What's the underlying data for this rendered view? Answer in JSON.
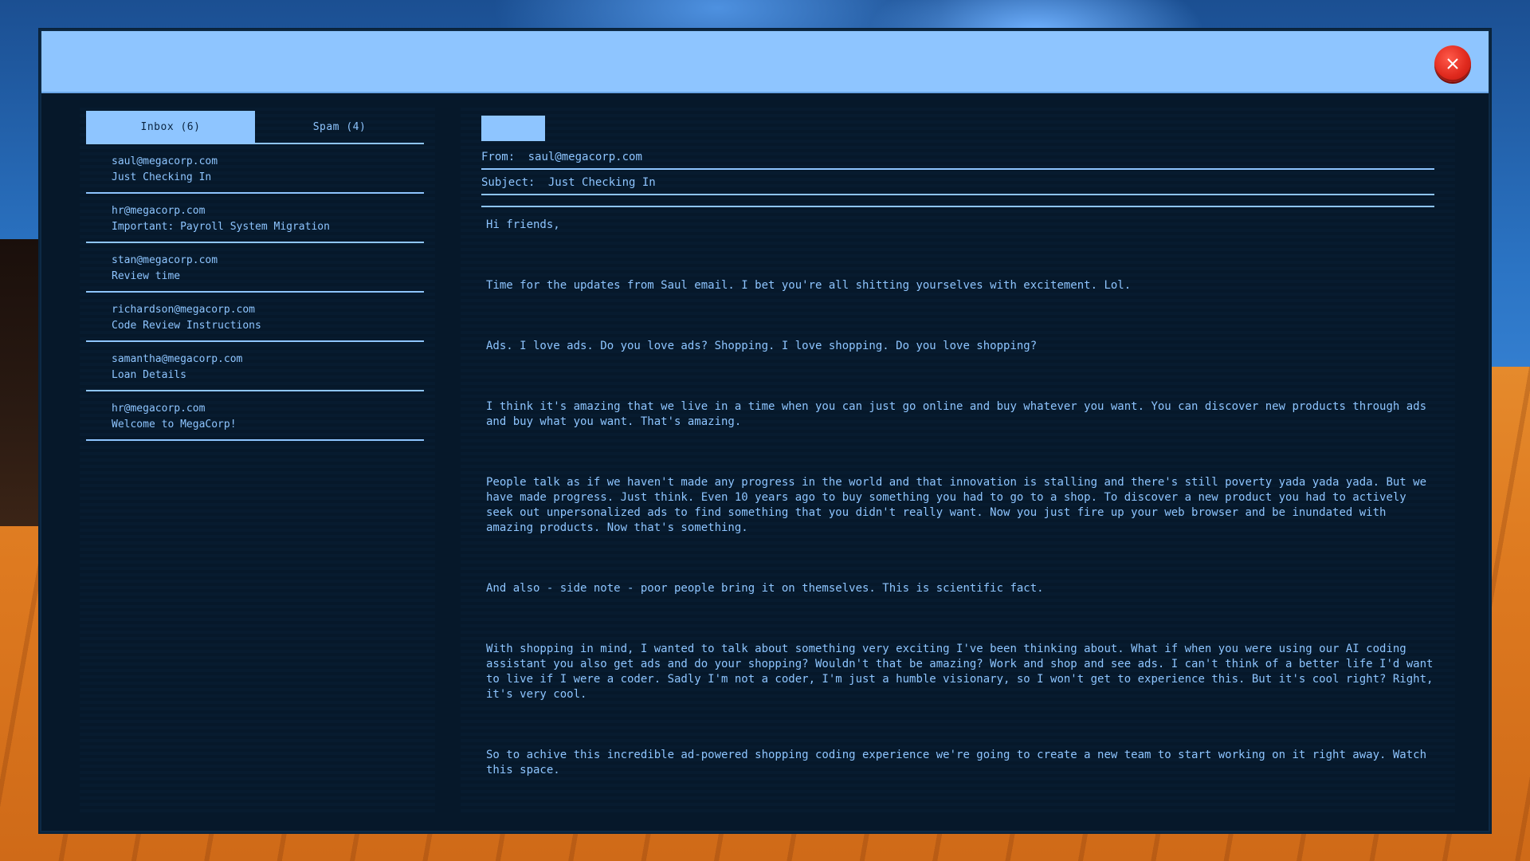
{
  "tabs": [
    {
      "label": "Inbox (6)",
      "active": true
    },
    {
      "label": "Spam (4)",
      "active": false
    }
  ],
  "emails": [
    {
      "from": "saul@megacorp.com",
      "subject": "Just Checking In"
    },
    {
      "from": "hr@megacorp.com",
      "subject": "Important: Payroll System Migration"
    },
    {
      "from": "stan@megacorp.com",
      "subject": "Review time"
    },
    {
      "from": "richardson@megacorp.com",
      "subject": "Code Review Instructions"
    },
    {
      "from": "samantha@megacorp.com",
      "subject": "Loan Details"
    },
    {
      "from": "hr@megacorp.com",
      "subject": "Welcome to MegaCorp!"
    }
  ],
  "reader": {
    "from_label": "From:",
    "from_value": "saul@megacorp.com",
    "subject_label": "Subject:",
    "subject_value": "Just Checking In",
    "paragraphs": [
      "Hi friends,",
      "Time for the updates from Saul email. I bet you're all shitting yourselves with excitement. Lol.",
      "Ads. I love ads. Do you love ads? Shopping. I love shopping. Do you love shopping?",
      "I think it's amazing that we live in a time when you can just go online and buy whatever you want. You can discover new products through ads and buy what you want. That's amazing.",
      "People talk as if we haven't made any progress in the world and that innovation is stalling and there's still poverty yada yada yada. But we have made progress. Just think. Even 10 years ago to buy something you had to go to a shop. To discover a new product you had to actively seek out unpersonalized ads to find something that you didn't really want. Now you just fire up your web browser and be inundated with amazing products. Now that's something.",
      "And also - side note - poor people bring it on themselves. This is scientific fact.",
      "With shopping in mind, I wanted to talk about something very exciting I've been thinking about. What if when you were using our AI coding assistant you also get ads and do your shopping? Wouldn't that be amazing? Work and shop and see ads. I can't think of a better life I'd want to live if I were a coder. Sadly I'm not a coder, I'm just a humble visionary, so I won't get to experience this. But it's cool right? Right, it's very cool.",
      "So to achive this incredible ad-powered shopping coding experience we're going to create a new team to start working on it right away. Watch this space."
    ]
  },
  "icons": {
    "close": "close-icon"
  },
  "colors": {
    "accent": "#8ec5ff",
    "panel": "#06182a",
    "close": "#e02a1e"
  }
}
